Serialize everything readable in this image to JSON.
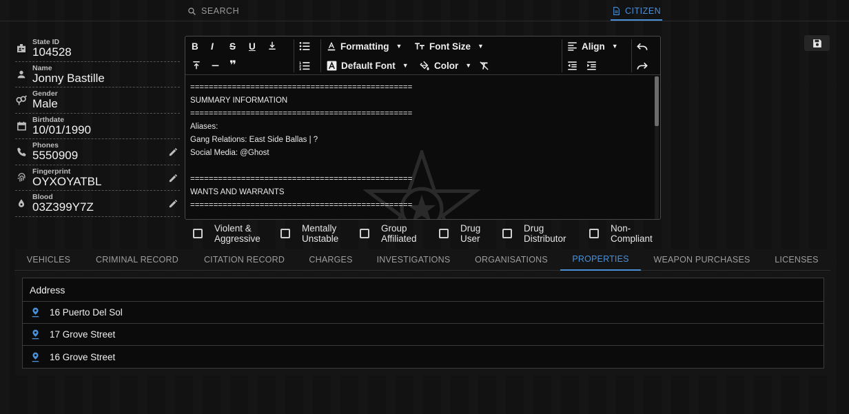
{
  "topbar": {
    "search_label": "SEARCH",
    "citizen_label": "CITIZEN"
  },
  "profile": {
    "state_id": {
      "label": "State ID",
      "value": "104528",
      "icon": "id-badge-icon"
    },
    "name": {
      "label": "Name",
      "value": "Jonny Bastille",
      "icon": "person-icon"
    },
    "gender": {
      "label": "Gender",
      "value": "Male",
      "icon": "gender-icon"
    },
    "birthdate": {
      "label": "Birthdate",
      "value": "10/01/1990",
      "icon": "calendar-icon"
    },
    "phones": {
      "label": "Phones",
      "value": "5550909",
      "icon": "phone-icon"
    },
    "fingerprint": {
      "label": "Fingerprint",
      "value": "OYXOYATBL",
      "icon": "fingerprint-icon"
    },
    "blood": {
      "label": "Blood",
      "value": "03Z399Y7Z",
      "icon": "blood-drop-icon"
    }
  },
  "editor": {
    "toolbar": {
      "formatting": "Formatting",
      "font_size": "Font Size",
      "align": "Align",
      "default_font": "Default Font",
      "color": "Color"
    },
    "lines": [
      "================================================",
      "SUMMARY INFORMATION",
      "================================================",
      "Aliases:",
      "Gang Relations: East Side Ballas | ?",
      "Social Media: @Ghost",
      "",
      "================================================",
      "WANTS AND WARRANTS",
      "================================================"
    ]
  },
  "flags": [
    {
      "l1": "Violent &",
      "l2": "Aggressive"
    },
    {
      "l1": "Mentally",
      "l2": "Unstable"
    },
    {
      "l1": "Group",
      "l2": "Affiliated"
    },
    {
      "l1": "Drug",
      "l2": "User"
    },
    {
      "l1": "Drug",
      "l2": "Distributor"
    },
    {
      "l1": "Non-",
      "l2": "Compliant"
    }
  ],
  "tabs": [
    "VEHICLES",
    "CRIMINAL RECORD",
    "CITATION RECORD",
    "CHARGES",
    "INVESTIGATIONS",
    "ORGANISATIONS",
    "PROPERTIES",
    "WEAPON PURCHASES",
    "LICENSES"
  ],
  "active_tab": "PROPERTIES",
  "properties_table": {
    "header": "Address",
    "rows": [
      "16 Puerto Del Sol",
      "17 Grove Street",
      "16 Grove Street"
    ]
  },
  "colors": {
    "accent": "#4a90d9",
    "background": "#121212"
  }
}
